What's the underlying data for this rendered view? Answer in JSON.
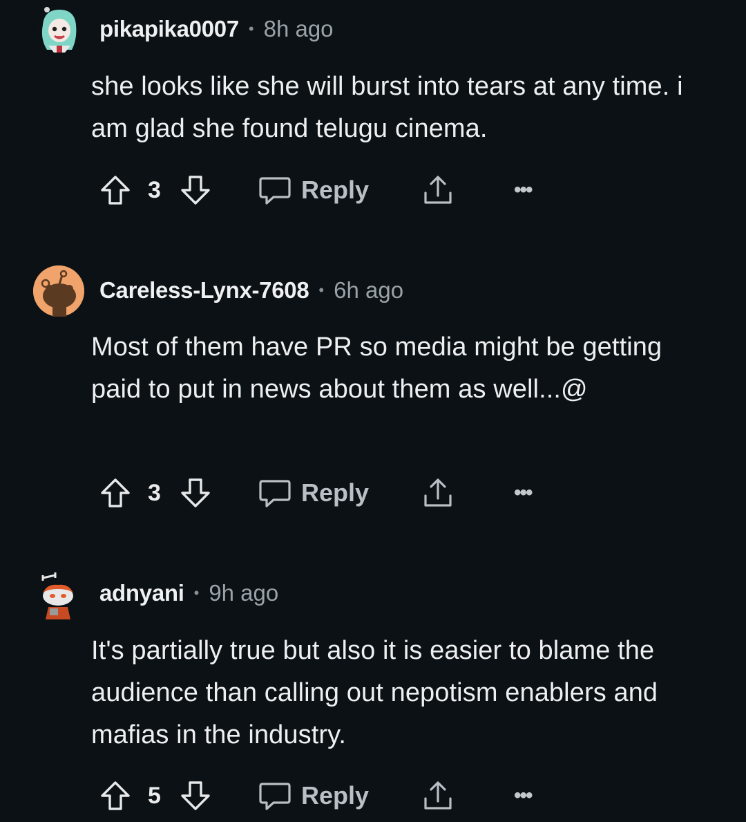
{
  "comments": [
    {
      "username": "pikapika0007",
      "separator": "•",
      "time": "8h ago",
      "body": "she looks like she will burst into tears at any time. i am glad she found telugu cinema.",
      "score": "3",
      "reply_label": "Reply",
      "more_label": "•••",
      "avatar_icon": "anime-character-avatar-icon"
    },
    {
      "username": "Careless-Lynx-7608",
      "separator": "•",
      "time": "6h ago",
      "body": "Most of them have PR so media might be getting paid to put in news about them as well...@",
      "score": "3",
      "reply_label": "Reply",
      "more_label": "•••",
      "avatar_icon": "default-snoo-avatar-icon"
    },
    {
      "username": "adnyani",
      "separator": "•",
      "time": "9h ago",
      "body": "It's partially true but also it is easier to blame the audience than calling out nepotism enablers and mafias in the industry.",
      "score": "5",
      "reply_label": "Reply",
      "more_label": "•••",
      "avatar_icon": "custom-snoo-avatar-icon"
    }
  ],
  "colors": {
    "background": "#0b1115",
    "text": "#edeff1",
    "muted": "#9ba3a8",
    "avatar_orange": "#f0a36a"
  }
}
